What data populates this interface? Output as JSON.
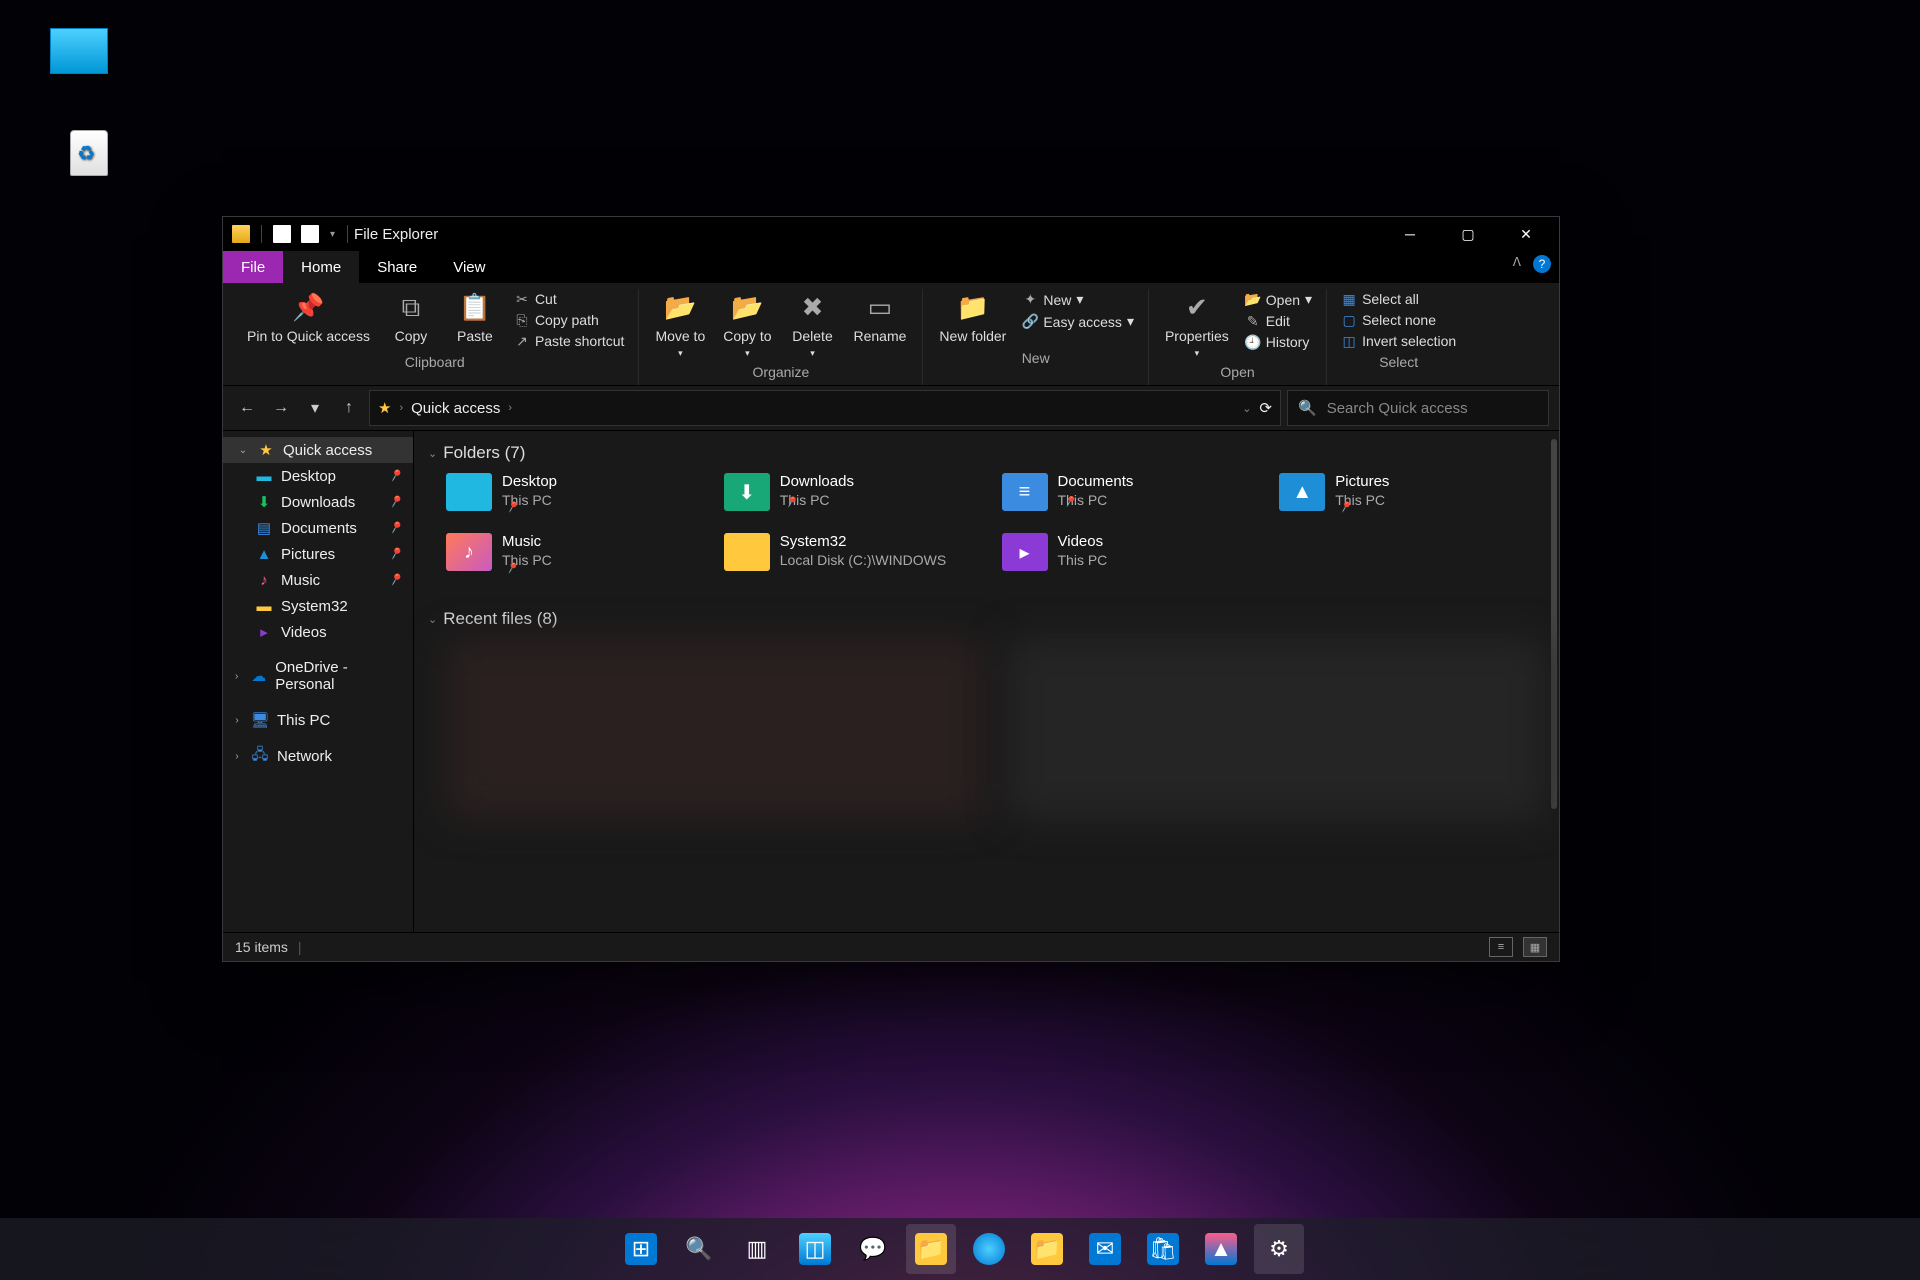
{
  "desktop_icons": {
    "monitor": "",
    "recycle": ""
  },
  "window": {
    "title": "File Explorer",
    "tabs": {
      "file": "File",
      "home": "Home",
      "share": "Share",
      "view": "View"
    },
    "ribbon": {
      "clipboard": {
        "label": "Clipboard",
        "pin": "Pin to Quick access",
        "copy": "Copy",
        "paste": "Paste",
        "cut": "Cut",
        "copypath": "Copy path",
        "pasteshortcut": "Paste shortcut"
      },
      "organize": {
        "label": "Organize",
        "moveto": "Move to",
        "copyto": "Copy to",
        "delete": "Delete",
        "rename": "Rename"
      },
      "new": {
        "label": "New",
        "newfolder": "New folder",
        "newitem": "New",
        "easyaccess": "Easy access"
      },
      "open": {
        "label": "Open",
        "properties": "Properties",
        "open": "Open",
        "edit": "Edit",
        "history": "History"
      },
      "select": {
        "label": "Select",
        "all": "Select all",
        "none": "Select none",
        "invert": "Invert selection"
      }
    },
    "address": {
      "location": "Quick access"
    },
    "search": {
      "placeholder": "Search Quick access"
    },
    "sidebar": {
      "quick": "Quick access",
      "items": [
        {
          "name": "Desktop",
          "pin": true
        },
        {
          "name": "Downloads",
          "pin": true
        },
        {
          "name": "Documents",
          "pin": true
        },
        {
          "name": "Pictures",
          "pin": true
        },
        {
          "name": "Music",
          "pin": true
        },
        {
          "name": "System32",
          "pin": false
        },
        {
          "name": "Videos",
          "pin": false
        }
      ],
      "onedrive": "OneDrive - Personal",
      "thispc": "This PC",
      "network": "Network"
    },
    "content": {
      "folders_hdr": "Folders (7)",
      "recent_hdr": "Recent files (8)",
      "folders": [
        {
          "name": "Desktop",
          "path": "This PC",
          "color": "#20b8e0",
          "icon": ""
        },
        {
          "name": "Downloads",
          "path": "This PC",
          "color": "#18a878",
          "icon": "⬇"
        },
        {
          "name": "Documents",
          "path": "This PC",
          "color": "#3b8be0",
          "icon": "≡"
        },
        {
          "name": "Pictures",
          "path": "This PC",
          "color": "#1e8fd6",
          "icon": "▲"
        },
        {
          "name": "Music",
          "path": "This PC",
          "color": "linear-gradient(135deg,#ff7a59,#c85bc0)",
          "icon": "♪"
        },
        {
          "name": "System32",
          "path": "Local Disk (C:)\\WINDOWS",
          "color": "#ffc83d",
          "icon": ""
        },
        {
          "name": "Videos",
          "path": "This PC",
          "color": "#8c3ad6",
          "icon": "▸"
        }
      ]
    },
    "status": {
      "count": "15 items"
    }
  }
}
